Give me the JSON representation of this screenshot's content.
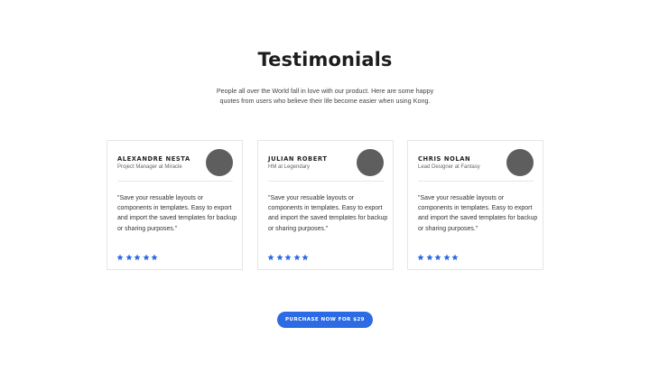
{
  "section": {
    "title": "Testimonials",
    "subtitle": "People all over the World fall in love with our product. Here are some happy quotes from users who believe their life become easier when using Kong."
  },
  "testimonials": [
    {
      "name": "ALEXANDRE NESTA",
      "role": "Project Manager at Miracle",
      "quote": "\"Save your resuable layouts or components in templates. Easy to export and import the saved templates for backup or sharing purposes.\"",
      "rating": 5
    },
    {
      "name": "JULIAN ROBERT",
      "role": "HM at Legendary",
      "quote": "\"Save your resuable layouts or components in templates. Easy to export and import the saved templates for backup or sharing purposes.\"",
      "rating": 5
    },
    {
      "name": "CHRIS NOLAN",
      "role": "Lead Designer at Fantasy",
      "quote": "\"Save your resuable layouts or components in templates. Easy to export and import the saved templates for backup or sharing purposes.\"",
      "rating": 5
    }
  ],
  "cta": {
    "label": "PURCHASE NOW FOR $29"
  },
  "colors": {
    "accent": "#2d6be4",
    "star": "#2d6be4",
    "avatar": "#5e5e5e",
    "border": "#e6e6e6"
  },
  "icons": {
    "rating": "star-icon"
  }
}
